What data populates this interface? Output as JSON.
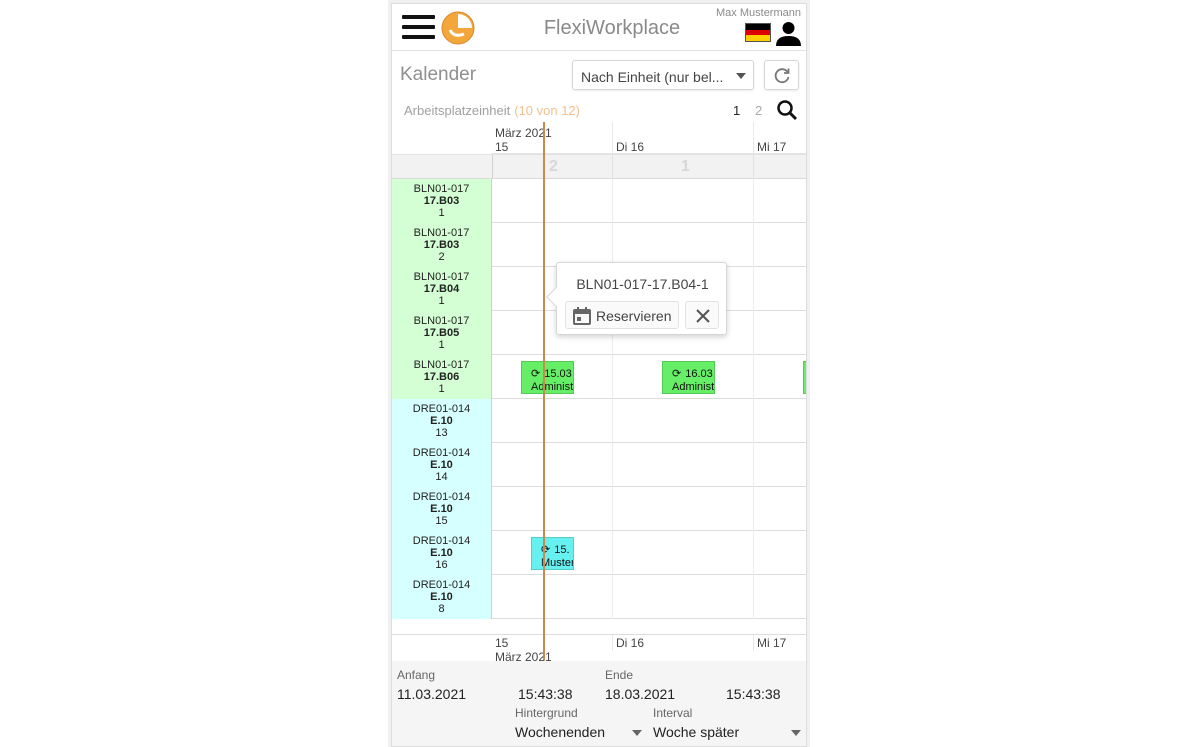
{
  "header": {
    "app_title": "FlexiWorkplace",
    "user_name": "Max Mustermann",
    "logo_color": "#f0a030"
  },
  "toolbar": {
    "page_title": "Kalender",
    "unit_select": "Nach Einheit (nur bel...",
    "unit_label": "Arbeitsplatzeinheit",
    "unit_count": "(10 von 12)",
    "pages": [
      "1",
      "2"
    ]
  },
  "timeline": {
    "month": "März 2021",
    "days": [
      "15",
      "Di 16",
      "Mi 17"
    ],
    "counts": [
      "2",
      "1"
    ]
  },
  "rows": [
    {
      "line1": "BLN01-017",
      "line2": "17.B03",
      "line3": "1",
      "color": "green"
    },
    {
      "line1": "BLN01-017",
      "line2": "17.B03",
      "line3": "2",
      "color": "green"
    },
    {
      "line1": "BLN01-017",
      "line2": "17.B04",
      "line3": "1",
      "color": "green"
    },
    {
      "line1": "BLN01-017",
      "line2": "17.B05",
      "line3": "1",
      "color": "green"
    },
    {
      "line1": "BLN01-017",
      "line2": "17.B06",
      "line3": "1",
      "color": "green"
    },
    {
      "line1": "DRE01-014",
      "line2": "E.10",
      "line3": "13",
      "color": "cyan"
    },
    {
      "line1": "DRE01-014",
      "line2": "E.10",
      "line3": "14",
      "color": "cyan"
    },
    {
      "line1": "DRE01-014",
      "line2": "E.10",
      "line3": "15",
      "color": "cyan"
    },
    {
      "line1": "DRE01-014",
      "line2": "E.10",
      "line3": "16",
      "color": "cyan"
    },
    {
      "line1": "DRE01-014",
      "line2": "E.10",
      "line3": "8",
      "color": "cyan"
    }
  ],
  "events": [
    {
      "l1": "15.03",
      "l2": "Administ"
    },
    {
      "l1": "16.03",
      "l2": "Administ"
    },
    {
      "l1": "15.",
      "l2": "Muster"
    }
  ],
  "popover": {
    "title": "BLN01-017-17.B04-1",
    "reserve_label": "Reservieren"
  },
  "footer": {
    "start_label": "Anfang",
    "start_date": "11.03.2021",
    "start_time": "15:43:38",
    "end_label": "Ende",
    "end_date": "18.03.2021",
    "end_time": "15:43:38",
    "background_label": "Hintergrund",
    "background_value": "Wochenenden",
    "interval_label": "Interval",
    "interval_value": "Woche später"
  },
  "colors": {
    "accent_now_line": "#d0884a",
    "event_green": "#66ee66",
    "event_cyan": "#66f0f0",
    "row_green": "#d4ffd4",
    "row_cyan": "#d6ffff"
  }
}
